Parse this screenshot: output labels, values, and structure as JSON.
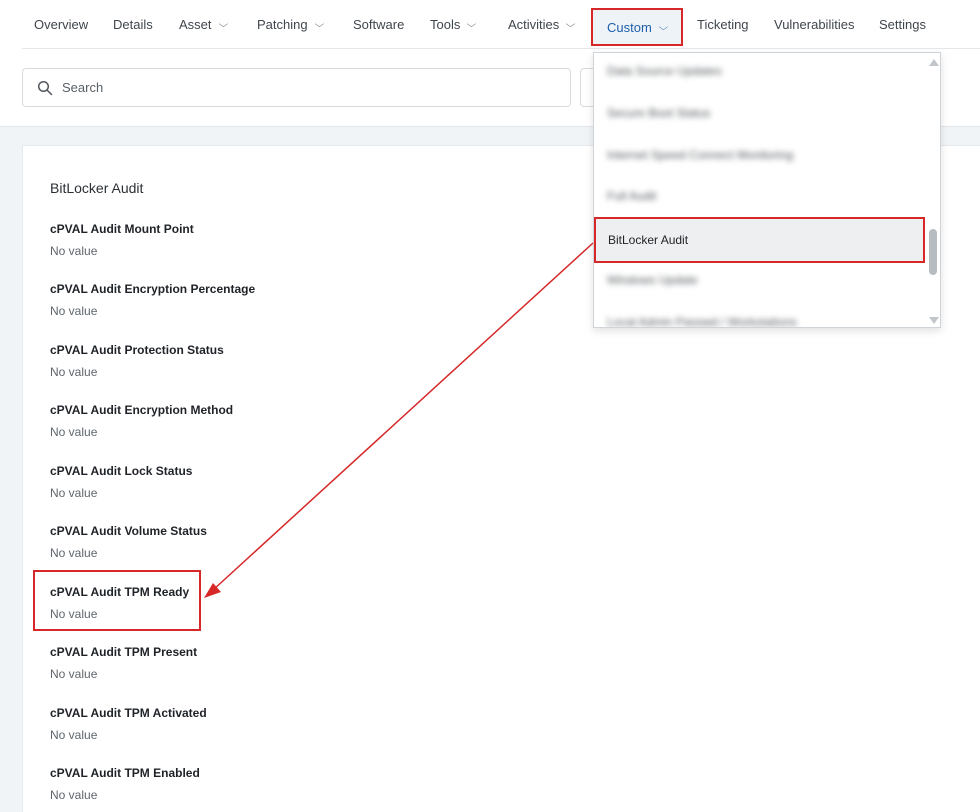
{
  "nav": {
    "tabs": [
      {
        "label": "Overview",
        "dropdown": false
      },
      {
        "label": "Details",
        "dropdown": false
      },
      {
        "label": "Asset",
        "dropdown": true
      },
      {
        "label": "Patching",
        "dropdown": true
      },
      {
        "label": "Software",
        "dropdown": false
      },
      {
        "label": "Tools",
        "dropdown": true
      },
      {
        "label": "Activities",
        "dropdown": true
      },
      {
        "label": "Custom",
        "dropdown": true,
        "active": true
      },
      {
        "label": "Ticketing",
        "dropdown": false
      },
      {
        "label": "Vulnerabilities",
        "dropdown": false
      },
      {
        "label": "Settings",
        "dropdown": false
      }
    ],
    "chevron": "⌵"
  },
  "search": {
    "placeholder": "Search",
    "icon": "search-icon"
  },
  "section": {
    "title": "BitLocker Audit",
    "fields": [
      {
        "label": "cPVAL Audit Mount Point",
        "value": "No value"
      },
      {
        "label": "cPVAL Audit Encryption Percentage",
        "value": "No value"
      },
      {
        "label": "cPVAL Audit Protection Status",
        "value": "No value"
      },
      {
        "label": "cPVAL Audit Encryption Method",
        "value": "No value"
      },
      {
        "label": "cPVAL Audit Lock Status",
        "value": "No value"
      },
      {
        "label": "cPVAL Audit Volume Status",
        "value": "No value"
      },
      {
        "label": "cPVAL Audit TPM Ready",
        "value": "No value",
        "highlighted": true
      },
      {
        "label": "cPVAL Audit TPM Present",
        "value": "No value"
      },
      {
        "label": "cPVAL Audit TPM Activated",
        "value": "No value"
      },
      {
        "label": "cPVAL Audit TPM Enabled",
        "value": "No value"
      }
    ]
  },
  "dropdown": {
    "items": [
      {
        "label": "Data Source Updates",
        "blurred": true
      },
      {
        "label": "Secure Boot Status",
        "blurred": true
      },
      {
        "label": "Internet Speed Connect Monitoring",
        "blurred": true
      },
      {
        "label": "Full Audit",
        "blurred": true
      },
      {
        "label": "BitLocker Audit",
        "selected": true
      },
      {
        "label": "Windows Update",
        "blurred": true
      },
      {
        "label": "Local Admin Passwd / Workstations",
        "blurred": true
      }
    ]
  },
  "colors": {
    "annotation": "#d62828",
    "active_tab_text": "#1d5faa",
    "page_background": "#f1f4f6"
  }
}
